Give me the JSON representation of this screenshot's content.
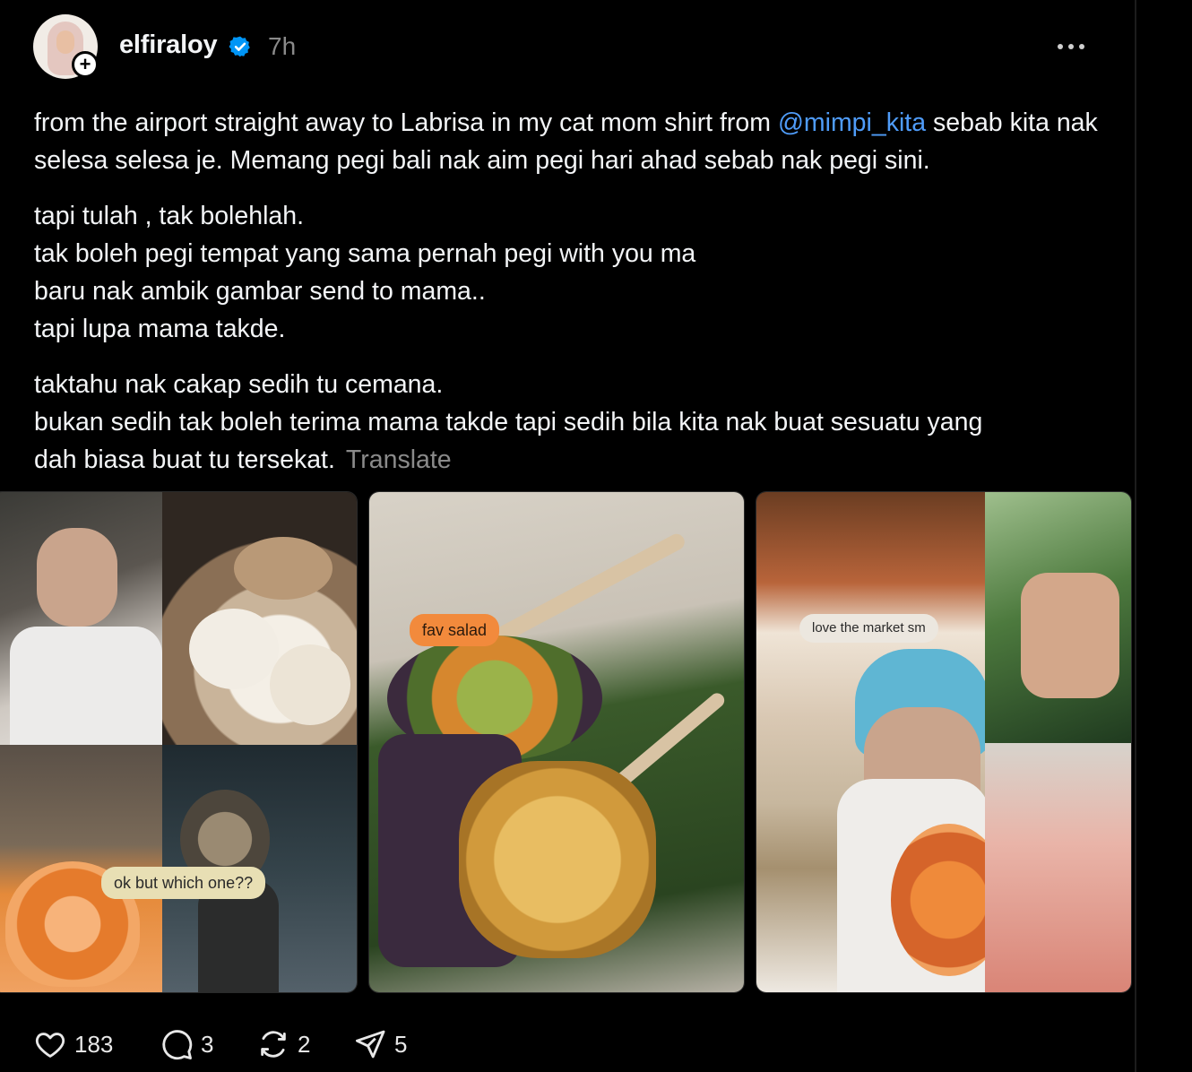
{
  "post": {
    "username": "elfiraloy",
    "time": "7h",
    "follow_symbol": "+",
    "paragraphs": {
      "p1_a": "from the airport straight away to Labrisa in my cat mom shirt from ",
      "p1_mention": "@mimpi_kita",
      "p1_b": " sebab kita nak selesa selesa je. Memang pegi bali nak aim pegi hari ahad sebab nak pegi sini.",
      "p2_l1": "tapi tulah , tak bolehlah.",
      "p2_l2": "tak boleh pegi tempat yang sama pernah pegi with you ma",
      "p2_l3": "baru nak ambik gambar send to mama..",
      "p2_l4": "tapi lupa mama takde.",
      "p3_l1": "taktahu nak cakap sedih tu cemana.",
      "p3_l2": "bukan sedih tak boleh terima mama takde tapi sedih bila kita nak buat sesuatu yang dah biasa buat tu tersekat."
    },
    "translate_label": "Translate",
    "stickers": {
      "img1": "ok but which one??",
      "img2": "fav salad",
      "img3": "love the market sm"
    },
    "actions": {
      "likes": "183",
      "comments": "3",
      "reposts": "2",
      "shares": "5"
    },
    "colors": {
      "background": "#000000",
      "text": "#f3f5f7",
      "mention": "#4f9cf9",
      "muted": "#8a8a8a",
      "verified": "#0095f6",
      "sticker_orange": "#f28a3c"
    },
    "icons": [
      "plus-icon",
      "verified-badge-icon",
      "more-dots-icon",
      "heart-icon",
      "comment-icon",
      "repost-icon",
      "share-icon"
    ]
  }
}
